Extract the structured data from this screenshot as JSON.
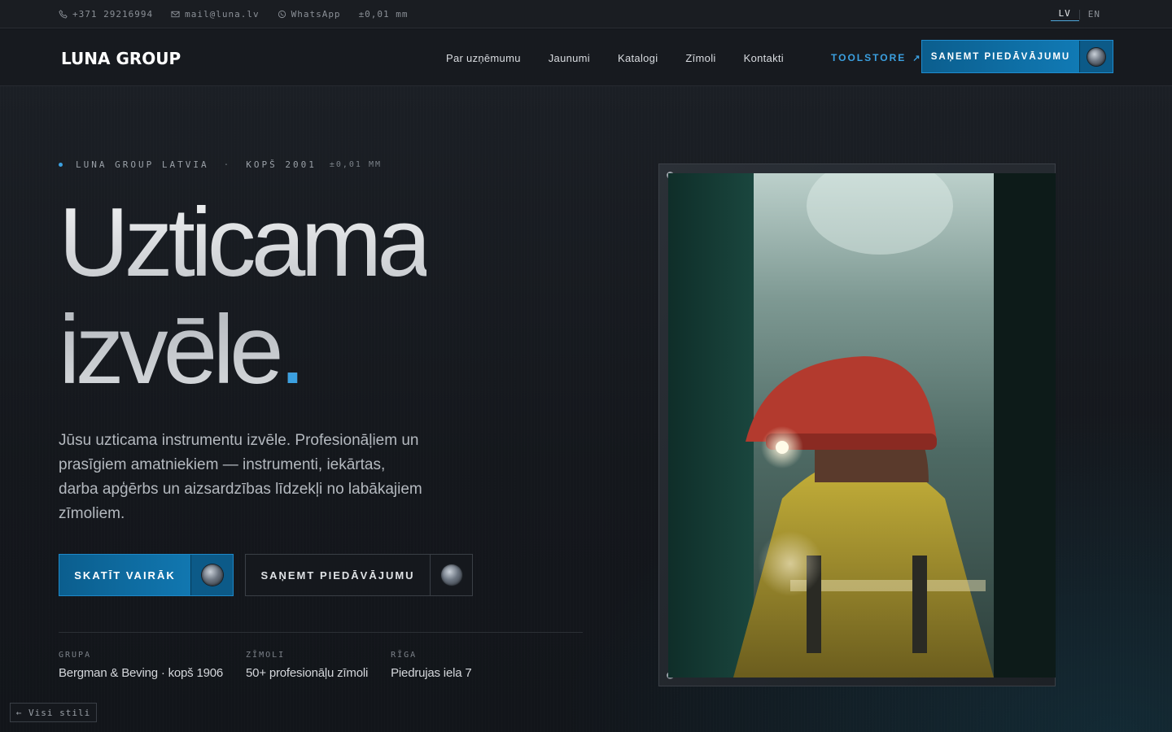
{
  "topbar": {
    "phone": "+371 29216994",
    "email": "mail@luna.lv",
    "whatsapp": "WhatsApp",
    "tolerance": "±0,01 mm",
    "lang_active": "LV",
    "lang_other": "EN"
  },
  "nav": {
    "logo": "LUNA GROUP",
    "links": [
      "Par uzņēmumu",
      "Jaunumi",
      "Katalogi",
      "Zīmoli",
      "Kontakti"
    ],
    "toolstore": "TOOLSTORE",
    "toolstore_arrow": "↗",
    "cta": "SAŅEMT PIEDĀVĀJUMU"
  },
  "hero": {
    "eyebrow_brand": "LUNA GROUP LATVIA",
    "eyebrow_sep": "·",
    "eyebrow_since": "KOPŠ 2001",
    "eyebrow_tol": "±0,01 MM",
    "headline_line1": "Uzticama",
    "headline_line2": "izvēle",
    "headline_period": ".",
    "lede": "Jūsu uzticama instrumentu izvēle. Profesionāļiem un prasīgiem amatniekiem — instrumenti, iekārtas, darba apģērbs un aizsardzības līdzekļi no labākajiem zīmoliem.",
    "btn_primary": "SKATĪT VAIRĀK",
    "btn_secondary": "SAŅEMT PIEDĀVĀJUMU"
  },
  "stats": [
    {
      "key": "GRUPA",
      "value": "Bergman & Beving · kopš 1906"
    },
    {
      "key": "ZĪMOLI",
      "value": "50+ profesionāļu zīmoli"
    },
    {
      "key": "RĪGA",
      "value": "Piedrujas iela 7"
    }
  ],
  "footer": {
    "back": "← Visi stili"
  },
  "colors": {
    "accent": "#3ba0e0",
    "cta_bg": "#0f6fa5",
    "page_bg": "#12151a"
  }
}
